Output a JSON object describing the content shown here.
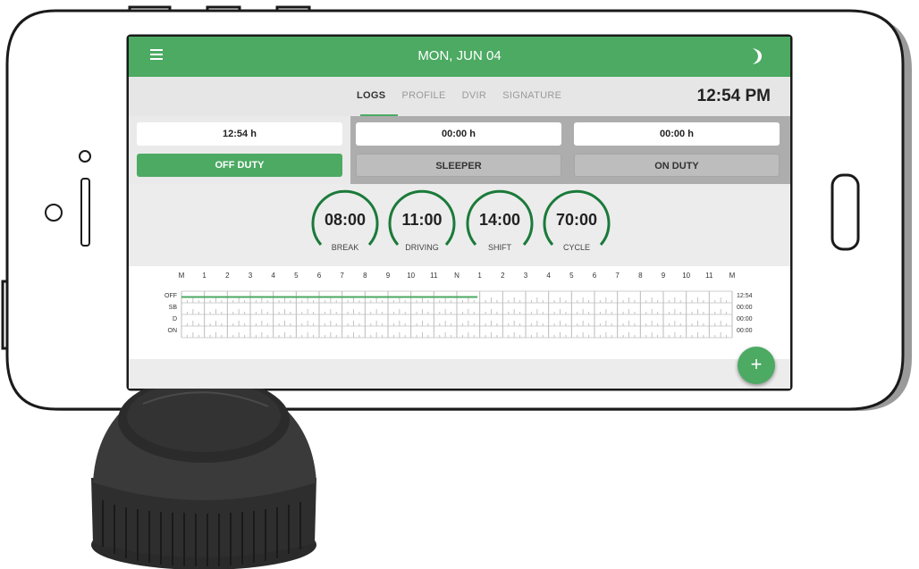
{
  "colors": {
    "accent": "#4caa63",
    "gauge_green": "#1b7a3a"
  },
  "appbar": {
    "date": "MON, JUN 04",
    "menu_icon": "menu-icon",
    "theme_icon": "moon-icon"
  },
  "tabs": [
    {
      "label": "LOGS",
      "active": true
    },
    {
      "label": "PROFILE",
      "active": false
    },
    {
      "label": "DVIR",
      "active": false
    },
    {
      "label": "SIGNATURE",
      "active": false
    }
  ],
  "clock": "12:54 PM",
  "duty": [
    {
      "time": "12:54 h",
      "label": "OFF DUTY",
      "active": true
    },
    {
      "time": "00:00 h",
      "label": "SLEEPER",
      "active": false
    },
    {
      "time": "00:00 h",
      "label": "ON DUTY",
      "active": false
    }
  ],
  "gauges": [
    {
      "value": "08:00",
      "label": "BREAK"
    },
    {
      "value": "11:00",
      "label": "DRIVING"
    },
    {
      "value": "14:00",
      "label": "SHIFT"
    },
    {
      "value": "70:00",
      "label": "CYCLE"
    }
  ],
  "log_graph": {
    "hours": [
      "M",
      "1",
      "2",
      "3",
      "4",
      "5",
      "6",
      "7",
      "8",
      "9",
      "10",
      "11",
      "N",
      "1",
      "2",
      "3",
      "4",
      "5",
      "6",
      "7",
      "8",
      "9",
      "10",
      "11",
      "M"
    ],
    "rows": [
      "OFF",
      "SB",
      "D",
      "ON"
    ],
    "totals": [
      "12:54",
      "00:00",
      "00:00",
      "00:00"
    ],
    "off_duty_hours": 12.9
  },
  "fab": {
    "label": "+"
  }
}
